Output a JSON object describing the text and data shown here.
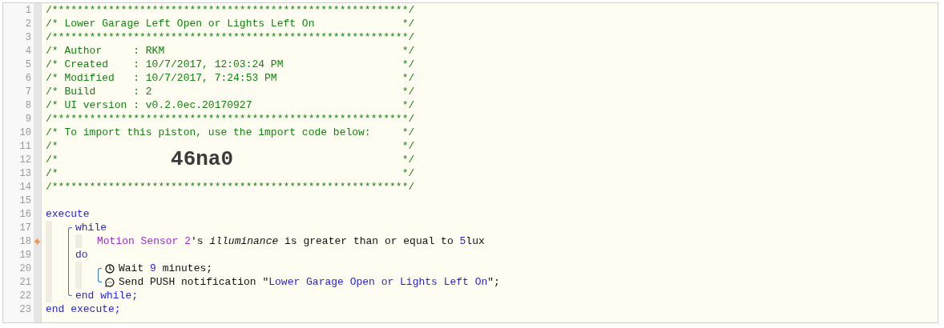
{
  "gutter": [
    {
      "number": "1",
      "flagged": false
    },
    {
      "number": "2",
      "flagged": false
    },
    {
      "number": "3",
      "flagged": false
    },
    {
      "number": "4",
      "flagged": false
    },
    {
      "number": "5",
      "flagged": false
    },
    {
      "number": "6",
      "flagged": false
    },
    {
      "number": "7",
      "flagged": false
    },
    {
      "number": "8",
      "flagged": false
    },
    {
      "number": "9",
      "flagged": false
    },
    {
      "number": "10",
      "flagged": false
    },
    {
      "number": "11",
      "flagged": false
    },
    {
      "number": "12",
      "flagged": false
    },
    {
      "number": "13",
      "flagged": false
    },
    {
      "number": "14",
      "flagged": false
    },
    {
      "number": "15",
      "flagged": false
    },
    {
      "number": "16",
      "flagged": false
    },
    {
      "number": "17",
      "flagged": false
    },
    {
      "number": "18",
      "flagged": true
    },
    {
      "number": "19",
      "flagged": false
    },
    {
      "number": "20",
      "flagged": false
    },
    {
      "number": "21",
      "flagged": false
    },
    {
      "number": "22",
      "flagged": false
    },
    {
      "number": "23",
      "flagged": false
    }
  ],
  "header": [
    {
      "kind": "rule",
      "text": "/*********************************************************/"
    },
    {
      "kind": "text",
      "text": "/* Lower Garage Left Open or Lights Left On",
      "end": "*/"
    },
    {
      "kind": "rule",
      "text": "/*********************************************************/"
    },
    {
      "kind": "text",
      "text": "/* Author     : RKM",
      "end": "*/"
    },
    {
      "kind": "text",
      "text": "/* Created    : 10/7/2017, 12:03:24 PM",
      "end": "*/"
    },
    {
      "kind": "text",
      "text": "/* Modified   : 10/7/2017, 7:24:53 PM",
      "end": "*/"
    },
    {
      "kind": "text",
      "text": "/* Build      : 2",
      "end": "*/"
    },
    {
      "kind": "text",
      "text": "/* UI version : v0.2.0ec.20170927",
      "end": "*/"
    },
    {
      "kind": "rule",
      "text": "/*********************************************************/"
    },
    {
      "kind": "text",
      "text": "/* To import this piston, use the import code below:",
      "end": "*/"
    },
    {
      "kind": "text",
      "text": "/*",
      "end": "*/"
    },
    {
      "kind": "code",
      "text": "/*",
      "code": "46na0",
      "end": "*/"
    },
    {
      "kind": "text",
      "text": "/*",
      "end": "*/"
    },
    {
      "kind": "rule",
      "text": "/*********************************************************/"
    }
  ],
  "program": {
    "open": [
      {
        "kind": "keyword",
        "text": "execute"
      }
    ],
    "body": [
      {
        "kind": "while",
        "open": [
          {
            "kind": "keyword",
            "text": "while"
          }
        ],
        "condition": [
          {
            "kind": "device",
            "text": "Motion Sensor 2"
          },
          {
            "kind": "plain",
            "text": "'s "
          },
          {
            "kind": "attribute",
            "text": "illuminance"
          },
          {
            "kind": "plain",
            "text": " is greater than or equal to "
          },
          {
            "kind": "number",
            "text": "5"
          },
          {
            "kind": "plain",
            "text": "lux"
          }
        ],
        "do": [
          {
            "kind": "keyword",
            "text": "do"
          }
        ],
        "actions": [
          {
            "kind": "wait",
            "tokens": [
              {
                "kind": "plain",
                "text": "Wait "
              },
              {
                "kind": "number",
                "text": "9"
              },
              {
                "kind": "plain",
                "text": " minutes;"
              }
            ]
          },
          {
            "kind": "notify",
            "tokens": [
              {
                "kind": "plain",
                "text": "Send PUSH notification \""
              },
              {
                "kind": "string",
                "text": "Lower Garage Open or Lights Left On"
              },
              {
                "kind": "plain",
                "text": "\";"
              }
            ]
          }
        ],
        "close": [
          {
            "kind": "keyword",
            "text": "end while;"
          }
        ]
      }
    ],
    "close": [
      {
        "kind": "keyword",
        "text": "end execute;"
      }
    ]
  }
}
